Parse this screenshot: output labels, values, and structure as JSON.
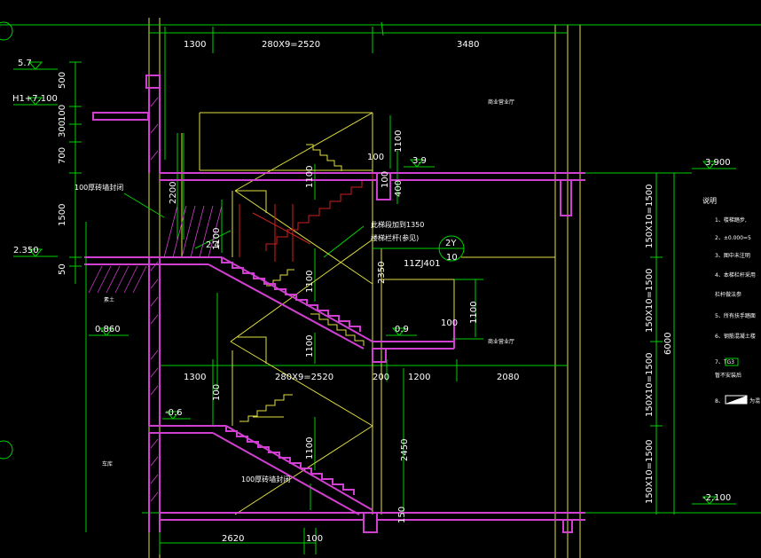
{
  "colors": {
    "background": "#000000",
    "dimension": "#00d000",
    "structure": "#d040d0",
    "stair_line": "#e0e040",
    "cut_line": "#d02020",
    "text": "#ffffff",
    "grid_axis": "#e0e040"
  },
  "dimensions_top": [
    "1300",
    "280X9=2520",
    "3480"
  ],
  "dimensions_mid": [
    "1300",
    "280X9=2520",
    "200",
    "1200",
    "2080"
  ],
  "dimensions_bottom": [
    "2620",
    "100"
  ],
  "dimensions_left_vertical": [
    "500",
    "100",
    "300",
    "700",
    "1500",
    "50"
  ],
  "elevations_left": [
    "5.7",
    "H1+7.100",
    "2.350",
    "0.860",
    "-0.6"
  ],
  "elevations_right": [
    "3.900",
    "-2.100"
  ],
  "elevations_inner": [
    "3.9",
    "0.9"
  ],
  "dimensions_right_vertical": [
    "150X10=1500",
    "150X10=1500",
    "150X10=1500",
    "150X10=1500",
    "6000"
  ],
  "dimensions_inner_vertical": [
    "1100",
    "1100",
    "1100",
    "1100",
    "1100",
    "1100",
    "1100",
    "2200",
    "2450",
    "400",
    "100",
    "100",
    "100",
    "100",
    "150",
    "2350"
  ],
  "labels": {
    "wall_seal_top": "100厚砖墙封闭",
    "wall_seal_bottom": "100厚砖墙封闭",
    "railing_note": "此梯段加到1350",
    "railing_name": "楼梯栏杆(参见)",
    "railing_ref": "11ZJ401",
    "detail_num": "2Y",
    "detail_sheet": "10",
    "dim_24": "2.4",
    "room_upper": "商业营业厅",
    "room_mid": "商业营业厅",
    "soil": "素土",
    "room_lower": "车库"
  },
  "notes": {
    "title": "说明",
    "items": [
      "1、楼梯踏步,",
      "2、±0.000=5",
      "3、图中未注明",
      "4、本梯栏杆采用",
      "栏杆做法参",
      "5、所有扶手踏面",
      "6、钢筋混凝土楼",
      "7、TG3 ",
      "暂不安装后",
      "8、"
    ],
    "legend_8": "为混"
  }
}
